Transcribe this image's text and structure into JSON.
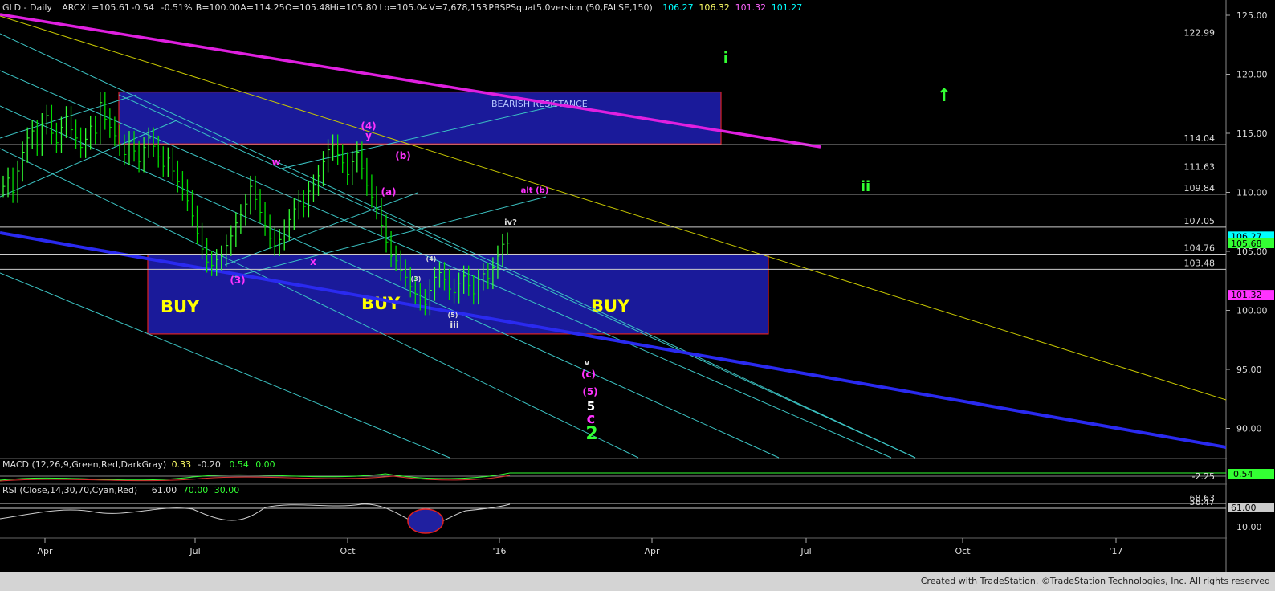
{
  "header": {
    "symbol": "GLD - Daily",
    "exchange": "ARCX",
    "last": "L=105.61",
    "change": "-0.54",
    "change_pct": "-0.51%",
    "b": "B=100.00",
    "a": "A=114.25",
    "o": "O=105.48",
    "hi": "Hi=105.80",
    "lo": "Lo=105.04",
    "vol": "V=7,678,153",
    "study": "PBSPSquat5.0version (50,FALSE,150)",
    "study_values": [
      "106.27",
      "106.32",
      "101.32",
      "101.27"
    ],
    "study_colors": [
      "#00ffff",
      "#ffff66",
      "#ff66ff",
      "#00ffff"
    ]
  },
  "chart_data": {
    "type": "line",
    "title": "GLD - Daily",
    "ylim": [
      87.5,
      125.5
    ],
    "y_ticks": [
      90,
      95,
      100,
      105,
      110,
      115,
      120,
      125
    ],
    "y_tick_labels": [
      "90.00",
      "95.00",
      "100.00",
      "105.00",
      "110.00",
      "115.00",
      "120.00",
      "125.00"
    ],
    "x_tick_labels": [
      "Apr",
      "Jul",
      "Oct",
      "'16",
      "Apr",
      "Jul",
      "Oct",
      "'17"
    ],
    "horizontal_levels": [
      {
        "value": 122.99,
        "label": "122.99"
      },
      {
        "value": 114.04,
        "label": "114.04"
      },
      {
        "value": 111.63,
        "label": "111.63"
      },
      {
        "value": 109.84,
        "label": "109.84"
      },
      {
        "value": 107.05,
        "label": "107.05"
      },
      {
        "value": 104.76,
        "label": "104.76"
      },
      {
        "value": 103.48,
        "label": "103.48"
      }
    ],
    "price_tags": [
      {
        "value": 106.27,
        "label": "106.27",
        "color": "#00ffff"
      },
      {
        "value": 105.68,
        "label": "105.68",
        "color": "#33ff33"
      },
      {
        "value": 101.32,
        "label": "101.32",
        "color": "#ff33ff"
      }
    ],
    "zones": [
      {
        "name": "bearish-resistance",
        "label": "BEARISH RESISTANCE",
        "y_top": 118.5,
        "y_bottom": 114.1
      },
      {
        "name": "buy-zone",
        "y_top": 104.76,
        "y_bottom": 98.0,
        "labels": [
          "BUY",
          "BUY",
          "BUY"
        ]
      }
    ],
    "series": [
      {
        "type": "ohlc",
        "values_by_session": [
          110.5,
          111.2,
          110.0,
          111.8,
          113.4,
          114.6,
          115.2,
          114.0,
          115.8,
          116.5,
          115.0,
          114.2,
          115.5,
          116.4,
          115.3,
          114.6,
          113.8,
          114.5,
          115.6,
          115.0,
          117.6,
          116.2,
          115.5,
          114.8,
          114.0,
          113.2,
          114.3,
          113.5,
          112.6,
          113.8,
          114.6,
          113.9,
          113.0,
          112.2,
          112.9,
          111.8,
          110.9,
          110.2,
          109.3,
          108.0,
          106.5,
          105.2,
          104.1,
          103.8,
          104.3,
          104.6,
          105.5,
          106.3,
          107.4,
          108.1,
          109.0,
          110.5,
          109.4,
          108.3,
          107.2,
          106.1,
          105.5,
          106.0,
          106.8,
          107.7,
          108.6,
          109.3,
          108.8,
          110.1,
          110.6,
          111.4,
          112.6,
          113.6,
          114.0,
          113.2,
          112.5,
          111.5,
          112.6,
          113.4,
          112.0,
          110.6,
          109.6,
          108.6,
          107.2,
          105.8,
          104.6,
          104.2,
          103.4,
          102.8,
          102.0,
          101.4,
          100.9,
          100.5,
          101.7,
          102.8,
          103.2,
          102.6,
          101.8,
          101.5,
          102.3,
          102.9,
          102.1,
          101.4,
          102.6,
          103.1,
          102.7,
          103.6,
          104.6,
          105.6,
          105.7
        ]
      }
    ],
    "wave_labels": [
      {
        "text": "(4)",
        "color": "#ff33ff"
      },
      {
        "text": "y",
        "color": "#ff33ff"
      },
      {
        "text": "(b)",
        "color": "#ff33ff"
      },
      {
        "text": "(a)",
        "color": "#ff33ff"
      },
      {
        "text": "w",
        "color": "#ff33ff"
      },
      {
        "text": "x",
        "color": "#ff33ff"
      },
      {
        "text": "(3)",
        "color": "#ff33ff"
      },
      {
        "text": "alt (b)",
        "color": "#ff33ff"
      },
      {
        "text": "iv?",
        "color": "#dddddd"
      },
      {
        "text": "iii",
        "color": "#dddddd"
      },
      {
        "text": "(4)",
        "color": "#dddddd"
      },
      {
        "text": "(3)",
        "color": "#dddddd"
      },
      {
        "text": "(5)",
        "color": "#dddddd"
      },
      {
        "text": "v",
        "color": "#dddddd"
      },
      {
        "text": "(c)",
        "color": "#ff33ff"
      },
      {
        "text": "(5)",
        "color": "#ff33ff"
      },
      {
        "text": "5",
        "color": "#ffffff"
      },
      {
        "text": "c",
        "color": "#ff33ff"
      },
      {
        "text": "2",
        "color": "#33ff33"
      },
      {
        "text": "i",
        "color": "#33ff33"
      },
      {
        "text": "ii",
        "color": "#33ff33"
      },
      {
        "text": "↑",
        "color": "#33ff33"
      }
    ]
  },
  "macd": {
    "label": "MACD (12,26,9,Green,Red,DarkGray)",
    "values": [
      "0.33",
      "-0.20",
      "0.54",
      "0.00"
    ],
    "value_colors": [
      "#ffff66",
      "#dddddd",
      "#33ff33",
      "#33ff33"
    ],
    "scale_label": "-2.25",
    "tag": "0.54"
  },
  "rsi": {
    "label": "RSI (Close,14,30,70,Cyan,Red)",
    "values": [
      "61.00",
      "70.00",
      "30.00"
    ],
    "value_colors": [
      "#dddddd",
      "#33ff33",
      "#33ff33"
    ],
    "scale_labels": [
      "68.63",
      "56.47",
      "10.00"
    ],
    "tag": "61.00"
  },
  "footer": {
    "credit": "Created with TradeStation. ©TradeStation Technologies, Inc. All rights reserved"
  }
}
